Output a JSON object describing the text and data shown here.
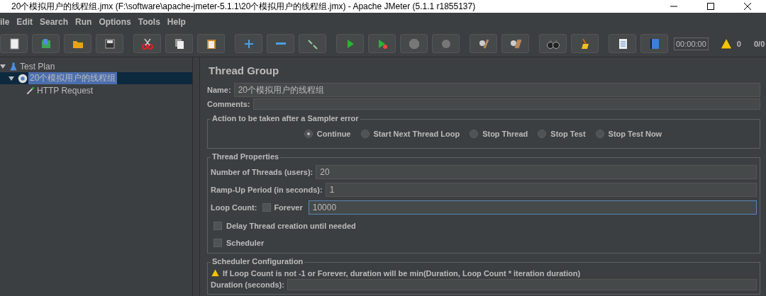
{
  "window": {
    "title": "20个模拟用户的线程组.jmx (F:\\software\\apache-jmeter-5.1.1\\20个模拟用户的线程组.jmx) - Apache JMeter (5.1.1 r1855137)"
  },
  "menu": [
    "ile",
    "Edit",
    "Search",
    "Run",
    "Options",
    "Tools",
    "Help"
  ],
  "toolbar": {
    "timer": "00:00:00",
    "warnings": "0",
    "threads": "0/0"
  },
  "tree": [
    {
      "label": "Test Plan",
      "kind": "plan",
      "selected": false,
      "expanded": true,
      "children": [
        {
          "label": "20个模拟用户的线程组",
          "kind": "group",
          "selected": true,
          "expanded": true,
          "children": [
            {
              "label": "HTTP Request",
              "kind": "sampler",
              "selected": false
            }
          ]
        }
      ]
    }
  ],
  "panel": {
    "title": "Thread Group",
    "name_label": "Name:",
    "name_value": "20个模拟用户的线程组",
    "comments_label": "Comments:",
    "error_action": {
      "title": "Action to be taken after a Sampler error",
      "options": [
        {
          "label": "Continue",
          "selected": true
        },
        {
          "label": "Start Next Thread Loop",
          "selected": false
        },
        {
          "label": "Stop Thread",
          "selected": false
        },
        {
          "label": "Stop Test",
          "selected": false
        },
        {
          "label": "Stop Test Now",
          "selected": false
        }
      ]
    },
    "thread_properties": {
      "title": "Thread Properties",
      "threads": {
        "label": "Number of Threads (users):",
        "value": "20"
      },
      "rampup": {
        "label": "Ramp-Up Period (in seconds):",
        "value": "1"
      },
      "loop": {
        "label": "Loop Count:",
        "forever_label": "Forever",
        "forever_checked": false,
        "value": "10000"
      },
      "checks": [
        {
          "label": "Delay Thread creation until needed",
          "checked": false
        },
        {
          "label": "Scheduler",
          "checked": false
        }
      ]
    },
    "scheduler": {
      "title": "Scheduler Configuration",
      "warning": "If Loop Count is not -1 or Forever, duration will be min(Duration, Loop Count * iteration duration)",
      "duration_label": "Duration (seconds):"
    }
  }
}
